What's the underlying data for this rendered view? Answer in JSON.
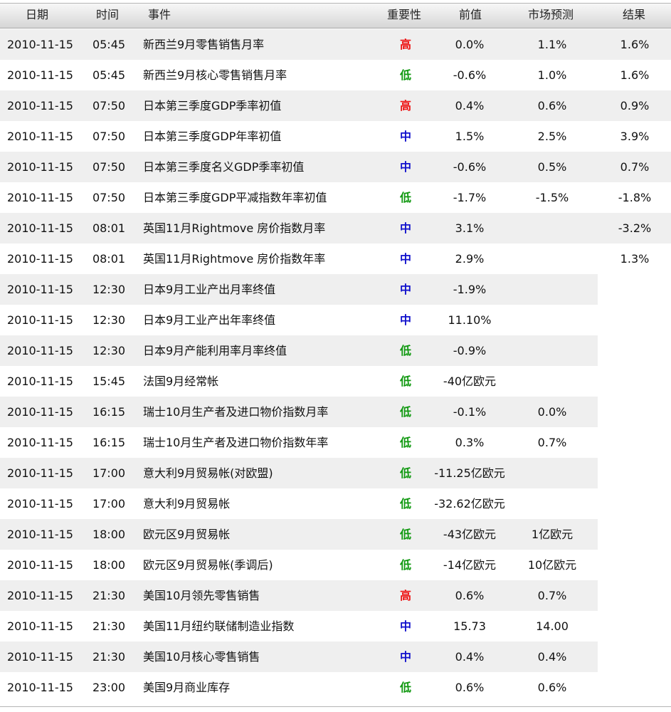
{
  "header": {
    "date": "日期",
    "time": "时间",
    "event": "事件",
    "importance": "重要性",
    "previous": "前值",
    "forecast": "市场预测",
    "result": "结果"
  },
  "colors": {
    "high": "#ee1111",
    "medium": "#1111cc",
    "low": "#119911",
    "row_shade": "#efefef"
  },
  "rows": [
    {
      "date": "2010-11-15",
      "time": "05:45",
      "event": "新西兰9月零售销售月率",
      "importance": "高",
      "level": "high",
      "previous": "0.0%",
      "forecast": "1.1%",
      "result": "1.6%"
    },
    {
      "date": "2010-11-15",
      "time": "05:45",
      "event": "新西兰9月核心零售销售月率",
      "importance": "低",
      "level": "low",
      "previous": "-0.6%",
      "forecast": "1.0%",
      "result": "1.6%"
    },
    {
      "date": "2010-11-15",
      "time": "07:50",
      "event": "日本第三季度GDP季率初值",
      "importance": "高",
      "level": "high",
      "previous": "0.4%",
      "forecast": "0.6%",
      "result": "0.9%"
    },
    {
      "date": "2010-11-15",
      "time": "07:50",
      "event": "日本第三季度GDP年率初值",
      "importance": "中",
      "level": "medium",
      "previous": "1.5%",
      "forecast": "2.5%",
      "result": "3.9%"
    },
    {
      "date": "2010-11-15",
      "time": "07:50",
      "event": "日本第三季度名义GDP季率初值",
      "importance": "中",
      "level": "medium",
      "previous": "-0.6%",
      "forecast": "0.5%",
      "result": "0.7%"
    },
    {
      "date": "2010-11-15",
      "time": "07:50",
      "event": "日本第三季度GDP平减指数年率初值",
      "importance": "低",
      "level": "low",
      "previous": "-1.7%",
      "forecast": "-1.5%",
      "result": "-1.8%"
    },
    {
      "date": "2010-11-15",
      "time": "08:01",
      "event": "英国11月Rightmove 房价指数月率",
      "importance": "中",
      "level": "medium",
      "previous": "3.1%",
      "forecast": "",
      "result": "-3.2%"
    },
    {
      "date": "2010-11-15",
      "time": "08:01",
      "event": "英国11月Rightmove 房价指数年率",
      "importance": "中",
      "level": "medium",
      "previous": "2.9%",
      "forecast": "",
      "result": "1.3%"
    },
    {
      "date": "2010-11-15",
      "time": "12:30",
      "event": "日本9月工业产出月率终值",
      "importance": "中",
      "level": "medium",
      "previous": "-1.9%",
      "forecast": "",
      "result": ""
    },
    {
      "date": "2010-11-15",
      "time": "12:30",
      "event": "日本9月工业产出年率终值",
      "importance": "中",
      "level": "medium",
      "previous": "11.10%",
      "forecast": "",
      "result": ""
    },
    {
      "date": "2010-11-15",
      "time": "12:30",
      "event": "日本9月产能利用率月率终值",
      "importance": "低",
      "level": "low",
      "previous": "-0.9%",
      "forecast": "",
      "result": ""
    },
    {
      "date": "2010-11-15",
      "time": "15:45",
      "event": "法国9月经常帐",
      "importance": "低",
      "level": "low",
      "previous": "-40亿欧元",
      "forecast": "",
      "result": ""
    },
    {
      "date": "2010-11-15",
      "time": "16:15",
      "event": "瑞士10月生产者及进口物价指数月率",
      "importance": "低",
      "level": "low",
      "previous": "-0.1%",
      "forecast": "0.0%",
      "result": ""
    },
    {
      "date": "2010-11-15",
      "time": "16:15",
      "event": "瑞士10月生产者及进口物价指数年率",
      "importance": "低",
      "level": "low",
      "previous": "0.3%",
      "forecast": "0.7%",
      "result": ""
    },
    {
      "date": "2010-11-15",
      "time": "17:00",
      "event": "意大利9月贸易帐(对欧盟)",
      "importance": "低",
      "level": "low",
      "previous": "-11.25亿欧元",
      "forecast": "",
      "result": ""
    },
    {
      "date": "2010-11-15",
      "time": "17:00",
      "event": "意大利9月贸易帐",
      "importance": "低",
      "level": "low",
      "previous": "-32.62亿欧元",
      "forecast": "",
      "result": ""
    },
    {
      "date": "2010-11-15",
      "time": "18:00",
      "event": "欧元区9月贸易帐",
      "importance": "低",
      "level": "low",
      "previous": "-43亿欧元",
      "forecast": "1亿欧元",
      "result": ""
    },
    {
      "date": "2010-11-15",
      "time": "18:00",
      "event": "欧元区9月贸易帐(季调后)",
      "importance": "低",
      "level": "low",
      "previous": "-14亿欧元",
      "forecast": "10亿欧元",
      "result": ""
    },
    {
      "date": "2010-11-15",
      "time": "21:30",
      "event": "美国10月领先零售销售",
      "importance": "高",
      "level": "high",
      "previous": "0.6%",
      "forecast": "0.7%",
      "result": ""
    },
    {
      "date": "2010-11-15",
      "time": "21:30",
      "event": "美国11月纽约联储制造业指数",
      "importance": "中",
      "level": "medium",
      "previous": "15.73",
      "forecast": "14.00",
      "result": ""
    },
    {
      "date": "2010-11-15",
      "time": "21:30",
      "event": "美国10月核心零售销售",
      "importance": "中",
      "level": "medium",
      "previous": "0.4%",
      "forecast": "0.4%",
      "result": ""
    },
    {
      "date": "2010-11-15",
      "time": "23:00",
      "event": "美国9月商业库存",
      "importance": "低",
      "level": "low",
      "previous": "0.6%",
      "forecast": "0.6%",
      "result": ""
    }
  ]
}
